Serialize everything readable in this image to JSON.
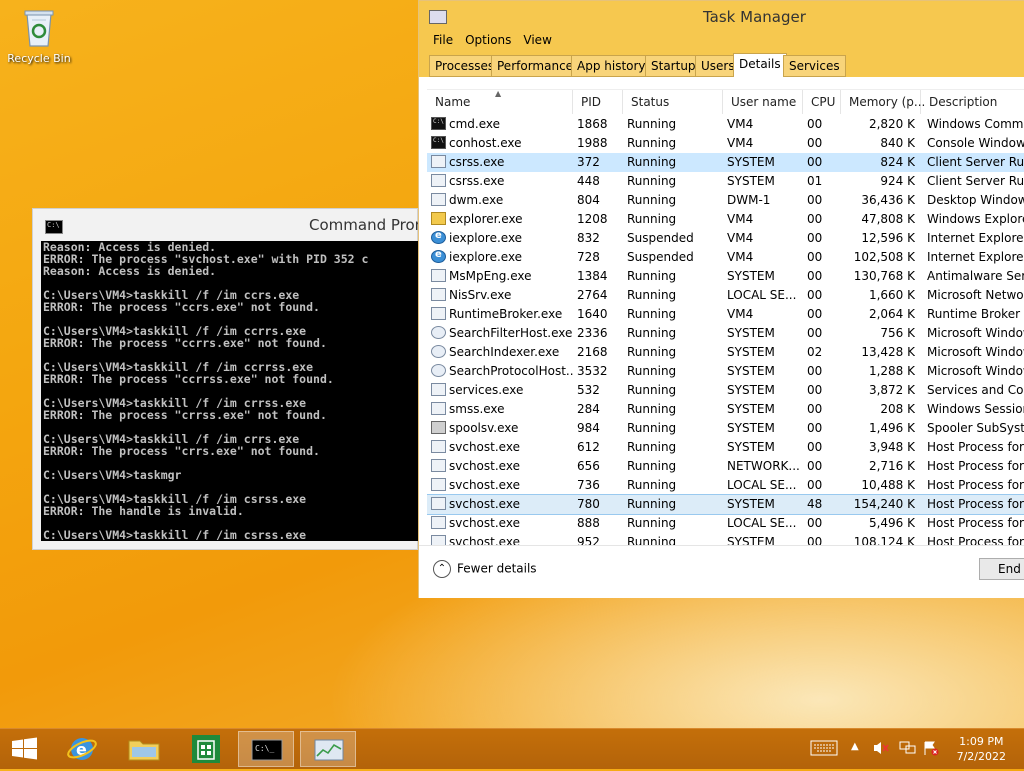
{
  "desktop": {
    "recycle_bin_label": "Recycle Bin"
  },
  "cmd_window": {
    "title": "Command Prompt",
    "lines": [
      "Reason: Access is denied.",
      "ERROR: The process \"svchost.exe\" with PID 352 c",
      "Reason: Access is denied.",
      "",
      "C:\\Users\\VM4>taskkill /f /im ccrs.exe",
      "ERROR: The process \"ccrs.exe\" not found.",
      "",
      "C:\\Users\\VM4>taskkill /f /im ccrrs.exe",
      "ERROR: The process \"ccrrs.exe\" not found.",
      "",
      "C:\\Users\\VM4>taskkill /f /im ccrrss.exe",
      "ERROR: The process \"ccrrss.exe\" not found.",
      "",
      "C:\\Users\\VM4>taskkill /f /im crrss.exe",
      "ERROR: The process \"crrss.exe\" not found.",
      "",
      "C:\\Users\\VM4>taskkill /f /im crrs.exe",
      "ERROR: The process \"crrs.exe\" not found.",
      "",
      "C:\\Users\\VM4>taskmgr",
      "",
      "C:\\Users\\VM4>taskkill /f /im csrss.exe",
      "ERROR: The handle is invalid.",
      "",
      "C:\\Users\\VM4>taskkill /f /im csrss.exe"
    ]
  },
  "task_manager": {
    "title": "Task Manager",
    "menu": [
      "File",
      "Options",
      "View"
    ],
    "tabs": [
      "Processes",
      "Performance",
      "App history",
      "Startup",
      "Users",
      "Details",
      "Services"
    ],
    "active_tab": "Details",
    "columns": [
      "Name",
      "PID",
      "Status",
      "User name",
      "CPU",
      "Memory (p...",
      "Description"
    ],
    "rows": [
      {
        "icon": "console",
        "name": "cmd.exe",
        "pid": "1868",
        "status": "Running",
        "user": "VM4",
        "cpu": "00",
        "mem": "2,820 K",
        "desc": "Windows Comma"
      },
      {
        "icon": "console",
        "name": "conhost.exe",
        "pid": "1988",
        "status": "Running",
        "user": "VM4",
        "cpu": "00",
        "mem": "840 K",
        "desc": "Console Window H"
      },
      {
        "icon": "window",
        "name": "csrss.exe",
        "pid": "372",
        "status": "Running",
        "user": "SYSTEM",
        "cpu": "00",
        "mem": "824 K",
        "desc": "Client Server Runti"
      },
      {
        "icon": "window",
        "name": "csrss.exe",
        "pid": "448",
        "status": "Running",
        "user": "SYSTEM",
        "cpu": "01",
        "mem": "924 K",
        "desc": "Client Server Runti"
      },
      {
        "icon": "window",
        "name": "dwm.exe",
        "pid": "804",
        "status": "Running",
        "user": "DWM-1",
        "cpu": "00",
        "mem": "36,436 K",
        "desc": "Desktop Window M"
      },
      {
        "icon": "folder",
        "name": "explorer.exe",
        "pid": "1208",
        "status": "Running",
        "user": "VM4",
        "cpu": "00",
        "mem": "47,808 K",
        "desc": "Windows Explorer"
      },
      {
        "icon": "ie",
        "name": "iexplore.exe",
        "pid": "832",
        "status": "Suspended",
        "user": "VM4",
        "cpu": "00",
        "mem": "12,596 K",
        "desc": "Internet Explorer"
      },
      {
        "icon": "ie",
        "name": "iexplore.exe",
        "pid": "728",
        "status": "Suspended",
        "user": "VM4",
        "cpu": "00",
        "mem": "102,508 K",
        "desc": "Internet Explorer"
      },
      {
        "icon": "window",
        "name": "MsMpEng.exe",
        "pid": "1384",
        "status": "Running",
        "user": "SYSTEM",
        "cpu": "00",
        "mem": "130,768 K",
        "desc": "Antimalware Servi"
      },
      {
        "icon": "window",
        "name": "NisSrv.exe",
        "pid": "2764",
        "status": "Running",
        "user": "LOCAL SE...",
        "cpu": "00",
        "mem": "1,660 K",
        "desc": "Microsoft Network"
      },
      {
        "icon": "window",
        "name": "RuntimeBroker.exe",
        "pid": "1640",
        "status": "Running",
        "user": "VM4",
        "cpu": "00",
        "mem": "2,064 K",
        "desc": "Runtime Broker"
      },
      {
        "icon": "search",
        "name": "SearchFilterHost.exe",
        "pid": "2336",
        "status": "Running",
        "user": "SYSTEM",
        "cpu": "00",
        "mem": "756 K",
        "desc": "Microsoft Window"
      },
      {
        "icon": "search",
        "name": "SearchIndexer.exe",
        "pid": "2168",
        "status": "Running",
        "user": "SYSTEM",
        "cpu": "02",
        "mem": "13,428 K",
        "desc": "Microsoft Window"
      },
      {
        "icon": "search",
        "name": "SearchProtocolHost....",
        "pid": "3532",
        "status": "Running",
        "user": "SYSTEM",
        "cpu": "00",
        "mem": "1,288 K",
        "desc": "Microsoft Window"
      },
      {
        "icon": "window",
        "name": "services.exe",
        "pid": "532",
        "status": "Running",
        "user": "SYSTEM",
        "cpu": "00",
        "mem": "3,872 K",
        "desc": "Services and Contr"
      },
      {
        "icon": "window",
        "name": "smss.exe",
        "pid": "284",
        "status": "Running",
        "user": "SYSTEM",
        "cpu": "00",
        "mem": "208 K",
        "desc": "Windows Session I"
      },
      {
        "icon": "printer",
        "name": "spoolsv.exe",
        "pid": "984",
        "status": "Running",
        "user": "SYSTEM",
        "cpu": "00",
        "mem": "1,496 K",
        "desc": "Spooler SubSysten"
      },
      {
        "icon": "window",
        "name": "svchost.exe",
        "pid": "612",
        "status": "Running",
        "user": "SYSTEM",
        "cpu": "00",
        "mem": "3,948 K",
        "desc": "Host Process for W"
      },
      {
        "icon": "window",
        "name": "svchost.exe",
        "pid": "656",
        "status": "Running",
        "user": "NETWORK...",
        "cpu": "00",
        "mem": "2,716 K",
        "desc": "Host Process for W"
      },
      {
        "icon": "window",
        "name": "svchost.exe",
        "pid": "736",
        "status": "Running",
        "user": "LOCAL SE...",
        "cpu": "00",
        "mem": "10,488 K",
        "desc": "Host Process for W"
      },
      {
        "icon": "window",
        "name": "svchost.exe",
        "pid": "780",
        "status": "Running",
        "user": "SYSTEM",
        "cpu": "48",
        "mem": "154,240 K",
        "desc": "Host Process for W"
      },
      {
        "icon": "window",
        "name": "svchost.exe",
        "pid": "888",
        "status": "Running",
        "user": "LOCAL SE...",
        "cpu": "00",
        "mem": "5,496 K",
        "desc": "Host Process for W"
      },
      {
        "icon": "window",
        "name": "svchost.exe",
        "pid": "952",
        "status": "Running",
        "user": "SYSTEM",
        "cpu": "00",
        "mem": "108,124 K",
        "desc": "Host Process for W"
      }
    ],
    "hover_row": 2,
    "selected_row": 20,
    "fewer_details": "Fewer details",
    "end_task": "End t"
  },
  "taskbar": {
    "time": "1:09 PM",
    "date": "7/2/2022",
    "colors": {
      "taskbar": "#b96808",
      "accent": "#f6c84f"
    }
  }
}
